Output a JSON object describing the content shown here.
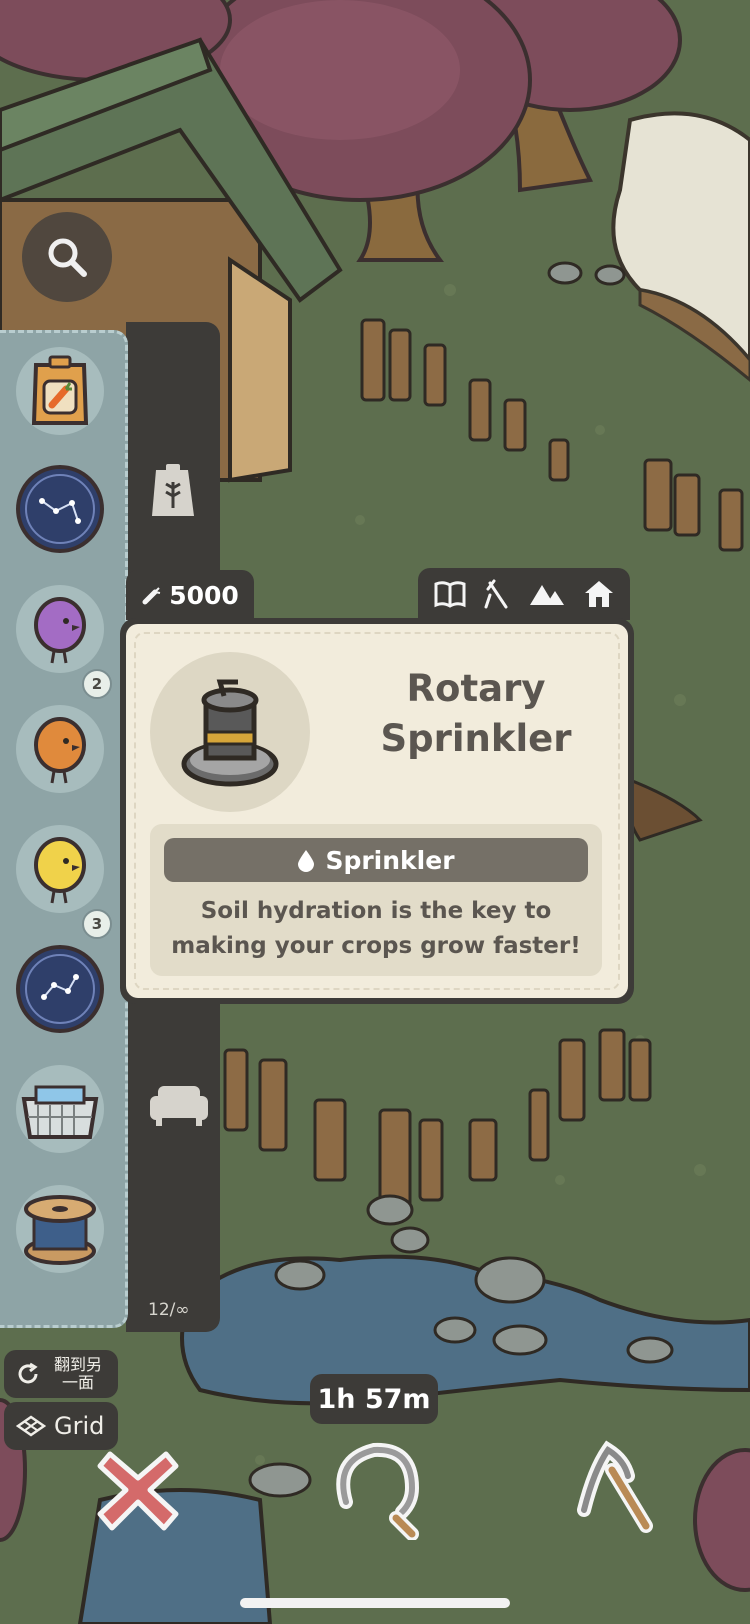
{
  "inventory": {
    "items": [
      {
        "name": "carrot-seed-packet"
      },
      {
        "name": "constellation-rug"
      },
      {
        "name": "purple-chick"
      },
      {
        "name": "orange-chick"
      },
      {
        "name": "yellow-chick"
      },
      {
        "name": "constellation-rug"
      },
      {
        "name": "glass-basket"
      },
      {
        "name": "wooden-spool"
      }
    ],
    "quantities": {
      "purple_chick": "2",
      "yellow_chick": "3"
    },
    "count_label": "12/∞"
  },
  "price": "5000",
  "item": {
    "title_line1": "Rotary",
    "title_line2": "Sprinkler",
    "category": "Sprinkler",
    "description_line1": "Soil hydration is the key to",
    "description_line2": "making your crops grow faster!"
  },
  "controls": {
    "flip_label_line1": "翻到另",
    "flip_label_line2": "一面",
    "grid_label": "Grid",
    "timer": "1h 57m"
  },
  "colors": {
    "panel_dark": "#3d3b38",
    "card_bg": "#f2ecdc",
    "inventory_bg": "#8ea4a6",
    "cancel_red": "#d46a6a"
  }
}
